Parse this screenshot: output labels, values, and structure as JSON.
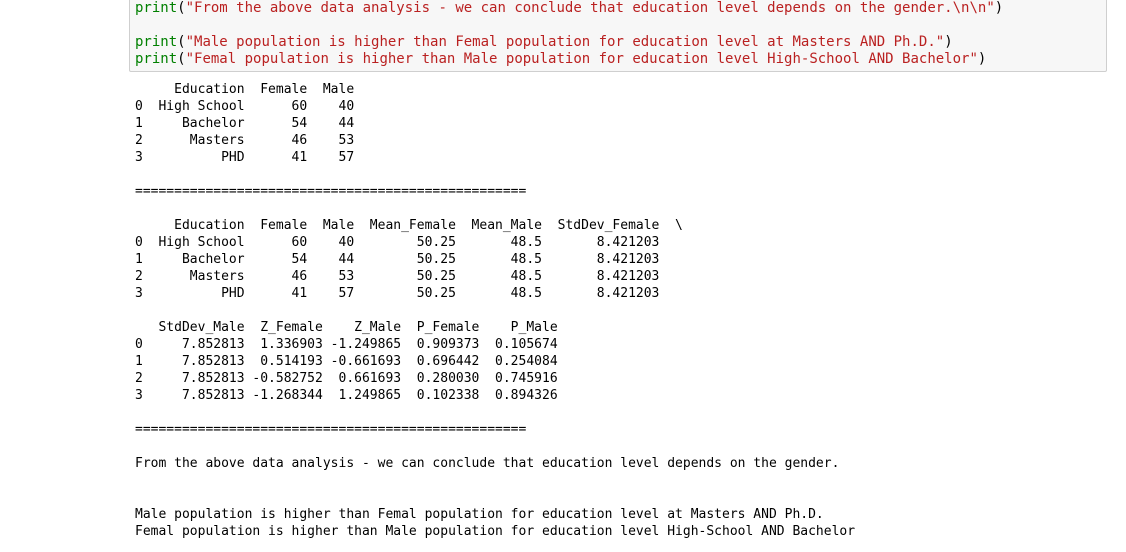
{
  "input": {
    "lines": [
      {
        "kw": "print",
        "open": "(",
        "str": "\"From the above data analysis - we can conclude that education level depends on the gender.\\n\\n\"",
        "close": ")"
      },
      {
        "kw": "print",
        "open": "(",
        "str": "\"Male population is higher than Femal population for education level at Masters AND Ph.D.\"",
        "close": ")"
      },
      {
        "kw": "print",
        "open": "(",
        "str": "\"Femal population is higher than Male population for education level High-School AND Bachelor\"",
        "close": ")"
      }
    ]
  },
  "output": {
    "table1": "     Education  Female  Male\n0  High School      60    40\n1     Bachelor      54    44\n2      Masters      46    53\n3          PHD      41    57",
    "separator1": "==================================================",
    "table2a": "     Education  Female  Male  Mean_Female  Mean_Male  StdDev_Female  \\\n0  High School      60    40        50.25       48.5       8.421203   \n1     Bachelor      54    44        50.25       48.5       8.421203   \n2      Masters      46    53        50.25       48.5       8.421203   \n3          PHD      41    57        50.25       48.5       8.421203   ",
    "table2b": "   StdDev_Male  Z_Female    Z_Male  P_Female    P_Male\n0     7.852813  1.336903 -1.249865  0.909373  0.105674\n1     7.852813  0.514193 -0.661693  0.696442  0.254084\n2     7.852813 -0.582752  0.661693  0.280030  0.745916\n3     7.852813 -1.268344  1.249865  0.102338  0.894326",
    "separator2": "==================================================",
    "conclusion": "From the above data analysis - we can conclude that education level depends on the gender.",
    "finding1": "Male population is higher than Femal population for education level at Masters AND Ph.D.",
    "finding2": "Femal population is higher than Male population for education level High-School AND Bachelor"
  }
}
